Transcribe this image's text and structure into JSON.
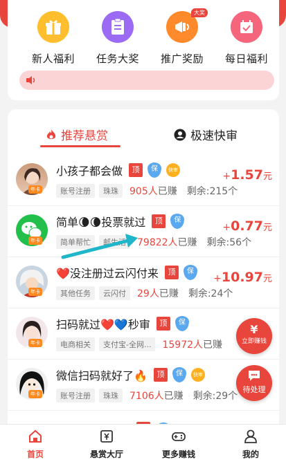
{
  "quick_actions": [
    {
      "label": "新人福利",
      "icon": "gift-icon",
      "color": "#ffbe2e"
    },
    {
      "label": "任务大奖",
      "icon": "task-list-icon",
      "color": "#9b6cf3"
    },
    {
      "label": "推广奖励",
      "icon": "megaphone-icon",
      "color": "#ff8a2c",
      "badge": "大奖"
    },
    {
      "label": "每日福利",
      "icon": "calendar-check-icon",
      "color": "#f5657c"
    }
  ],
  "tabs": {
    "recommended": "推荐悬赏",
    "fast": "极速快审"
  },
  "badges": {
    "top": "顶",
    "guarantee": "保",
    "fast": "快审"
  },
  "avatar_tag": "年卡",
  "tasks": [
    {
      "title": "小孩子都会做",
      "tags": [
        "账号注册",
        "珠珠"
      ],
      "earned_count": "905人",
      "earned_suffix": "已赚",
      "remaining": "剩余:215个",
      "price_plus": "+",
      "price": "1.57",
      "unit": "元"
    },
    {
      "title": "简单🌘🌘投票就过",
      "tags": [
        "简单帮忙",
        "邮生活"
      ],
      "earned_count": "79822人",
      "earned_suffix": "已赚",
      "remaining": "剩余:56个",
      "price_plus": "+",
      "price": "0.77",
      "unit": "元"
    },
    {
      "title": "❤️没注册过云闪付来",
      "tags": [
        "其他任务",
        "云闪付"
      ],
      "earned_count": "29人",
      "earned_suffix": "已赚",
      "remaining": "剩余:24个",
      "price_plus": "+",
      "price": "10.97",
      "unit": "元"
    },
    {
      "title": "扫码就过❤️💙秒审",
      "tags": [
        "电商相关",
        "支付宝-全网..."
      ],
      "earned_count": "15972人",
      "earned_suffix": "已赚",
      "remaining": "",
      "price_plus": "",
      "price": "",
      "unit": ""
    },
    {
      "title": "微信扫码就好了🔥",
      "tags": [
        "账号注册",
        "珠珠"
      ],
      "earned_count": "7106人",
      "earned_suffix": "已赚",
      "remaining": "剩余:29个",
      "price_plus": "",
      "price": "",
      "unit": ""
    }
  ],
  "floating": {
    "earn_label": "立即赚钱",
    "earn_symbol": "¥",
    "pending_label": "待处理"
  },
  "nav": [
    {
      "label": "首页",
      "icon": "home-icon",
      "active": true
    },
    {
      "label": "悬赏大厅",
      "icon": "reward-hall-icon",
      "active": false
    },
    {
      "label": "更多赚钱",
      "icon": "gamepad-icon",
      "active": false
    },
    {
      "label": "我的",
      "icon": "user-icon",
      "active": false
    }
  ],
  "colors": {
    "accent": "#e8453c",
    "notice_bg": "#fbd5d6"
  }
}
